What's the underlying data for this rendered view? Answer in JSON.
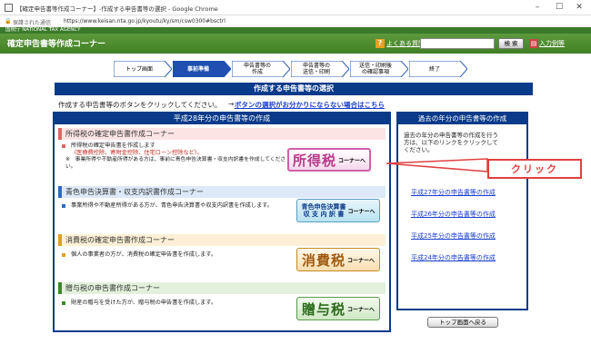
{
  "window": {
    "title": "【確定申告書等作成コーナー】-作成する申告書等の選択 - Google Chrome",
    "security": "保護された通信",
    "url": "https://www.keisan.nta.go.jp/kyoutu/ky/sm/csw0300#bsctrl"
  },
  "site": {
    "agency": "国税庁  NATIONAL TAX AGENCY",
    "corner_title": "確定申告書等作成コーナー",
    "faq_label": "よくある質問",
    "search_button": "検 索",
    "help_label": "入力例等"
  },
  "steps": [
    {
      "label": "トップ画面",
      "active": false
    },
    {
      "label": "事前準備",
      "active": true
    },
    {
      "label": "申告書等の\n作成",
      "active": false
    },
    {
      "label": "申告書等の\n送信・印刷",
      "active": false
    },
    {
      "label": "送信・印刷後\nの確認事項",
      "active": false
    },
    {
      "label": "終了",
      "active": false
    }
  ],
  "page": {
    "heading": "作成する申告書等の選択",
    "instruction": "作成する申告書等のボタンをクリックしてください。",
    "arrow": "→",
    "instruction_link": "ボタンの選択がお分かりにならない場合はこちら"
  },
  "left_panel": {
    "title": "平成28年分の申告書等の作成",
    "sections": [
      {
        "heading": "所得税の確定申告書作成コーナー",
        "desc_line1": "所得税の確定申告書を作成します",
        "desc_line2": "（医療費控除、寄附金控除、住宅ローン控除など）。",
        "note": "※　事業所得や不動産所得がある方は、事前に青色申告決算書・収支内訳書を作成してください。",
        "button_big": "所得税",
        "button_small": "コーナーへ",
        "color": "#e06666"
      },
      {
        "heading": "青色申告決算書・収支内訳書作成コーナー",
        "desc_line1": "事業所得や不動産所得がある方が、青色申告決算書や収支内訳書を作成します。",
        "button_top": "青色申告決算書",
        "button_bottom": "収 支 内 訳 書",
        "button_small": "コーナーへ",
        "color": "#2a6cc2"
      },
      {
        "heading": "消費税の確定申告書作成コーナー",
        "desc_line1": "個人の事業者の方が、消費税の確定申告書を作成します。",
        "button_big": "消費税",
        "button_small": "コーナーへ",
        "color": "#e0a020"
      },
      {
        "heading": "贈与税の申告書作成コーナー",
        "desc_line1": "財産の贈与を受けた方が、贈与税の申告書を作成します。",
        "button_big": "贈与税",
        "button_small": "コーナーへ",
        "color": "#3a8a2a"
      }
    ]
  },
  "right_panel": {
    "title": "過去の年分の申告書等の作成",
    "desc": "過去の年分の申告書等の作成を行う方は、以下のリンクをクリックしてください。",
    "links": [
      "平成27年分の申告書等の作成",
      "平成26年分の申告書等の作成",
      "平成25年分の申告書等の作成",
      "平成24年分の申告書等の作成"
    ]
  },
  "back_button": "トップ画面へ戻る",
  "annotation": "クリック"
}
